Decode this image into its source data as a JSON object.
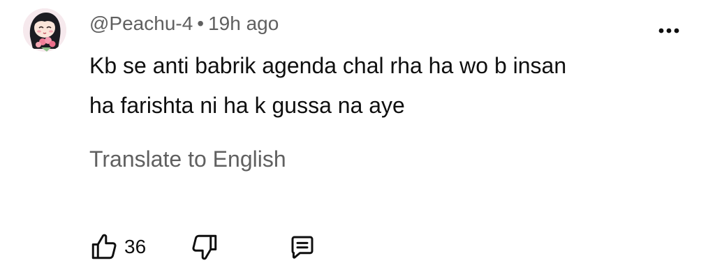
{
  "comment": {
    "author": "@Peachu-4",
    "separator": "•",
    "timestamp": "19h ago",
    "text": "Kb se anti babrik agenda chal rha ha wo b insan\nha farishta ni ha k gussa na aye",
    "translate_label": "Translate to English",
    "like_count": "36"
  },
  "icons": {
    "more": "more-vert-icon",
    "like": "thumbs-up-icon",
    "dislike": "thumbs-down-icon",
    "reply": "reply-comment-icon"
  },
  "colors": {
    "primary_text": "#0f0f0f",
    "secondary_text": "#606060",
    "background": "#ffffff"
  }
}
